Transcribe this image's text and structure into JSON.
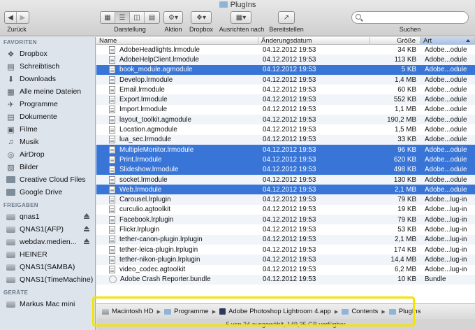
{
  "window": {
    "title": "PlugIns"
  },
  "toolbar": {
    "back_label": "Zurück",
    "view_label": "Darstellung",
    "action_label": "Aktion",
    "dropbox_label": "Dropbox",
    "arrange_label": "Ausrichten nach",
    "share_label": "Bereitstellen",
    "search_label": "Suchen",
    "search_value": ""
  },
  "sidebar": {
    "favorites_header": "FAVORITEN",
    "favorites": [
      {
        "label": "Dropbox",
        "icon": "dropbox-icon"
      },
      {
        "label": "Schreibtisch",
        "icon": "desktop-icon"
      },
      {
        "label": "Downloads",
        "icon": "downloads-icon"
      },
      {
        "label": "Alle meine Dateien",
        "icon": "all-files-icon"
      },
      {
        "label": "Programme",
        "icon": "applications-icon"
      },
      {
        "label": "Dokumente",
        "icon": "documents-icon"
      },
      {
        "label": "Filme",
        "icon": "movies-icon"
      },
      {
        "label": "Musik",
        "icon": "music-icon"
      },
      {
        "label": "AirDrop",
        "icon": "airdrop-icon"
      },
      {
        "label": "Bilder",
        "icon": "pictures-icon"
      },
      {
        "label": "Creative Cloud Files",
        "icon": "folder-icon"
      },
      {
        "label": "Google Drive",
        "icon": "folder-icon"
      }
    ],
    "shared_header": "FREIGABEN",
    "shared": [
      {
        "label": "qnas1",
        "eject": true
      },
      {
        "label": "QNAS1(AFP)",
        "eject": true
      },
      {
        "label": "webdav.medien...",
        "eject": true
      },
      {
        "label": "HEINER",
        "eject": false
      },
      {
        "label": "QNAS1(SAMBA)",
        "eject": false
      },
      {
        "label": "QNAS1(TimeMachine)",
        "eject": false
      }
    ],
    "devices_header": "GERÄTE",
    "devices": [
      {
        "label": "Markus Mac mini"
      }
    ]
  },
  "columns": {
    "name": "Name",
    "date": "Änderungsdatum",
    "size": "Größe",
    "kind": "Art"
  },
  "files": [
    {
      "name": "AdobeHeadlights.lrmodule",
      "date": "04.12.2012 19:53",
      "size": "34 KB",
      "kind": "Adobe...odule",
      "selected": false
    },
    {
      "name": "AdobeHelpClient.lrmodule",
      "date": "04.12.2012 19:53",
      "size": "113 KB",
      "kind": "Adobe...odule",
      "selected": false
    },
    {
      "name": "book_module.agmodule",
      "date": "04.12.2012 19:53",
      "size": "5 KB",
      "kind": "Adobe...odule",
      "selected": true
    },
    {
      "name": "Develop.lrmodule",
      "date": "04.12.2012 19:53",
      "size": "1,4 MB",
      "kind": "Adobe...odule",
      "selected": false
    },
    {
      "name": "Email.lrmodule",
      "date": "04.12.2012 19:53",
      "size": "60 KB",
      "kind": "Adobe...odule",
      "selected": false
    },
    {
      "name": "Export.lrmodule",
      "date": "04.12.2012 19:53",
      "size": "552 KB",
      "kind": "Adobe...odule",
      "selected": false
    },
    {
      "name": "Import.lrmodule",
      "date": "04.12.2012 19:53",
      "size": "1,1 MB",
      "kind": "Adobe...odule",
      "selected": false
    },
    {
      "name": "layout_toolkit.agmodule",
      "date": "04.12.2012 19:53",
      "size": "190,2 MB",
      "kind": "Adobe...odule",
      "selected": false
    },
    {
      "name": "Location.agmodule",
      "date": "04.12.2012 19:53",
      "size": "1,5 MB",
      "kind": "Adobe...odule",
      "selected": false
    },
    {
      "name": "lua_sec.lrmodule",
      "date": "04.12.2012 19:53",
      "size": "33 KB",
      "kind": "Adobe...odule",
      "selected": false
    },
    {
      "name": "MultipleMonitor.lrmodule",
      "date": "04.12.2012 19:53",
      "size": "96 KB",
      "kind": "Adobe...odule",
      "selected": true
    },
    {
      "name": "Print.lrmodule",
      "date": "04.12.2012 19:53",
      "size": "620 KB",
      "kind": "Adobe...odule",
      "selected": true
    },
    {
      "name": "Slideshow.lrmodule",
      "date": "04.12.2012 19:53",
      "size": "498 KB",
      "kind": "Adobe...odule",
      "selected": true
    },
    {
      "name": "socket.lrmodule",
      "date": "04.12.2012 19:53",
      "size": "130 KB",
      "kind": "Adobe...odule",
      "selected": false
    },
    {
      "name": "Web.lrmodule",
      "date": "04.12.2012 19:53",
      "size": "2,1 MB",
      "kind": "Adobe...odule",
      "selected": true
    },
    {
      "name": "Carousel.lrplugin",
      "date": "04.12.2012 19:53",
      "size": "79 KB",
      "kind": "Adobe...lug-in",
      "selected": false
    },
    {
      "name": "curculio.agtoolkit",
      "date": "04.12.2012 19:53",
      "size": "19 KB",
      "kind": "Adobe...lug-in",
      "selected": false
    },
    {
      "name": "Facebook.lrplugin",
      "date": "04.12.2012 19:53",
      "size": "79 KB",
      "kind": "Adobe...lug-in",
      "selected": false
    },
    {
      "name": "Flickr.lrplugin",
      "date": "04.12.2012 19:53",
      "size": "53 KB",
      "kind": "Adobe...lug-in",
      "selected": false
    },
    {
      "name": "tether-canon-plugin.lrplugin",
      "date": "04.12.2012 19:53",
      "size": "2,1 MB",
      "kind": "Adobe...lug-in",
      "selected": false
    },
    {
      "name": "tether-leica-plugin.lrplugin",
      "date": "04.12.2012 19:53",
      "size": "174 KB",
      "kind": "Adobe...lug-in",
      "selected": false
    },
    {
      "name": "tether-nikon-plugin.lrplugin",
      "date": "04.12.2012 19:53",
      "size": "14,4 MB",
      "kind": "Adobe...lug-in",
      "selected": false
    },
    {
      "name": "video_codec.agtoolkit",
      "date": "04.12.2012 19:53",
      "size": "6,2 MB",
      "kind": "Adobe...lug-in",
      "selected": false
    },
    {
      "name": "Adobe Crash Reporter.bundle",
      "date": "04.12.2012 19:53",
      "size": "10 KB",
      "kind": "Bundle",
      "selected": false,
      "bundle": true
    }
  ],
  "pathbar": [
    {
      "label": "Macintosh HD",
      "icon": "hard-drive-icon"
    },
    {
      "label": "Programme",
      "icon": "folder-icon"
    },
    {
      "label": "Adobe Photoshop Lightroom 4.app",
      "icon": "app-icon"
    },
    {
      "label": "Contents",
      "icon": "folder-icon"
    },
    {
      "label": "PlugIns",
      "icon": "folder-icon"
    }
  ],
  "status": "5 von 24 ausgewählt, 149,35 GB verfügbar",
  "colors": {
    "selection": "#3875d7",
    "highlight": "#f5e400",
    "sidebar": "#dde4ec"
  }
}
